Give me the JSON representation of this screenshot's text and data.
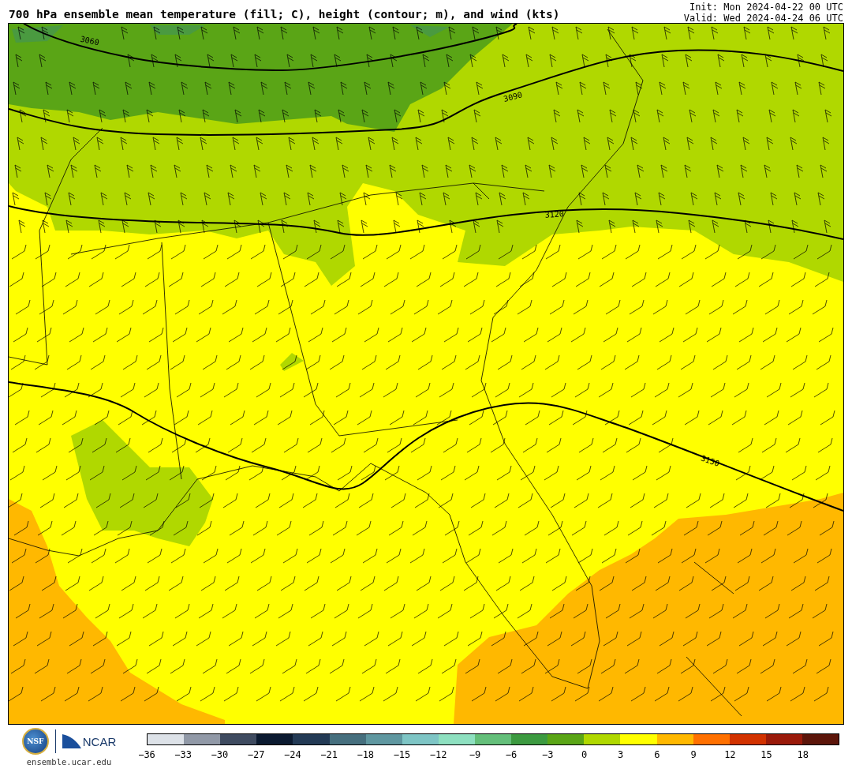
{
  "header": {
    "title": "700 hPa ensemble mean temperature (fill; C), height (contour; m), and wind (kts)",
    "init": "Init: Mon 2024-04-22 00 UTC",
    "valid": "Valid: Wed 2024-04-24 06 UTC"
  },
  "map": {
    "contours": [
      {
        "label": "3060"
      },
      {
        "label": "3090"
      },
      {
        "label": "3120"
      },
      {
        "label": "3150"
      }
    ]
  },
  "footer": {
    "logos": [
      {
        "kind": "nsf",
        "text": "NSF"
      },
      {
        "kind": "ncar",
        "text": "NCAR"
      }
    ],
    "url": "ensemble.ucar.edu"
  },
  "colorbar": {
    "segments": [
      {
        "color": "#dde2e8"
      },
      {
        "color": "#9199a7"
      },
      {
        "color": "#3f4b60"
      },
      {
        "color": "#0b1a30"
      },
      {
        "color": "#233a55"
      },
      {
        "color": "#466f7e"
      },
      {
        "color": "#5f97a0"
      },
      {
        "color": "#7ec5c5"
      },
      {
        "color": "#8ee0c0"
      },
      {
        "color": "#64bf7a"
      },
      {
        "color": "#3c9a40"
      },
      {
        "color": "#5aa516"
      },
      {
        "color": "#b0d800"
      },
      {
        "color": "#ffff00"
      },
      {
        "color": "#ffb800"
      },
      {
        "color": "#ff7000"
      },
      {
        "color": "#d23200"
      },
      {
        "color": "#9a1a0a"
      },
      {
        "color": "#5c150a"
      }
    ],
    "ticks": [
      "−36",
      "−33",
      "−30",
      "−27",
      "−24",
      "−21",
      "−18",
      "−15",
      "−12",
      "−9",
      "−6",
      "−3",
      "0",
      "3",
      "6",
      "9",
      "12",
      "15",
      "18"
    ]
  }
}
